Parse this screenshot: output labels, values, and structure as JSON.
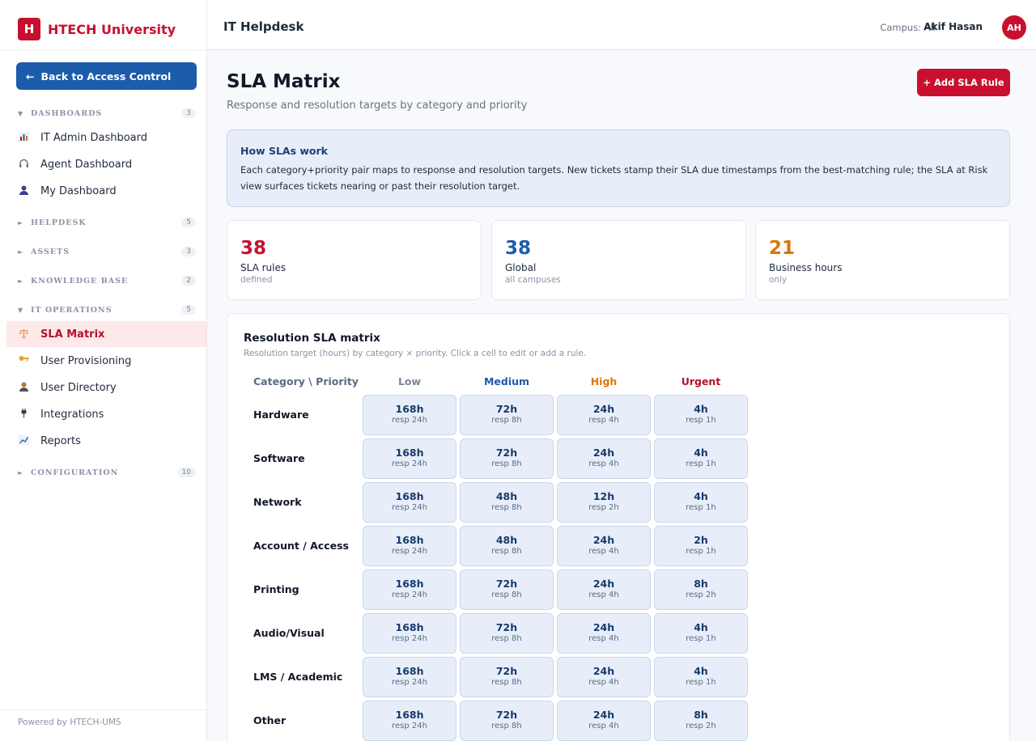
{
  "brand": {
    "logo_letter": "H",
    "name": "HTECH University",
    "accent": "#c8102e"
  },
  "sidebar": {
    "back_label": "Back to Access Control",
    "back_arrow": "←",
    "sections": [
      {
        "label": "DASHBOARDS",
        "count": "3",
        "caret": "▼"
      },
      {
        "label": "HELPDESK",
        "count": "5",
        "caret": "►"
      },
      {
        "label": "ASSETS",
        "count": "3",
        "caret": "►"
      },
      {
        "label": "KNOWLEDGE BASE",
        "count": "2",
        "caret": "►"
      },
      {
        "label": "IT OPERATIONS",
        "count": "5",
        "caret": "▼"
      },
      {
        "label": "CONFIGURATION",
        "count": "10",
        "caret": "►"
      }
    ],
    "items": [
      {
        "label": "IT Admin Dashboard",
        "icon": "bar-chart-icon"
      },
      {
        "label": "Agent Dashboard",
        "icon": "headset-icon"
      },
      {
        "label": "My Dashboard",
        "icon": "person-icon"
      },
      {
        "label": "SLA Matrix",
        "icon": "scales-icon"
      },
      {
        "label": "User Provisioning",
        "icon": "key-icon"
      },
      {
        "label": "User Directory",
        "icon": "person-icon"
      },
      {
        "label": "Integrations",
        "icon": "plug-icon"
      },
      {
        "label": "Reports",
        "icon": "line-chart-icon"
      }
    ],
    "footer": "Powered by HTECH-UMS"
  },
  "topbar": {
    "title": "IT Helpdesk",
    "campus": "Campus: All",
    "user_name": "Akif Hasan",
    "user_initials": "AH"
  },
  "page": {
    "title": "SLA Matrix",
    "subtitle": "Response and resolution targets by category and priority",
    "add_button": "+ Add SLA Rule"
  },
  "info": {
    "title": "How SLAs work",
    "body": "Each category+priority pair maps to response and resolution targets. New tickets stamp their SLA due timestamps from the best-matching rule; the SLA at Risk view surfaces tickets nearing or past their resolution target."
  },
  "stats": [
    {
      "value": "38",
      "label": "SLA rules",
      "sub": "defined",
      "color": "#c8102e"
    },
    {
      "value": "38",
      "label": "Global",
      "sub": "all campuses",
      "color": "#1d5bab"
    },
    {
      "value": "21",
      "label": "Business hours",
      "sub": "only",
      "color": "#d97706"
    }
  ],
  "matrix": {
    "title": "Resolution SLA matrix",
    "subtitle": "Resolution target (hours) by category × priority. Click a cell to edit or add a rule.",
    "corner": "Category \\ Priority",
    "priorities": [
      {
        "label": "Low",
        "color": "#7b8597"
      },
      {
        "label": "Medium",
        "color": "#1d5bab"
      },
      {
        "label": "High",
        "color": "#d97706"
      },
      {
        "label": "Urgent",
        "color": "#b3122b"
      }
    ],
    "rows": [
      {
        "category": "Hardware",
        "cells": [
          {
            "res": "168h",
            "resp": "resp 24h"
          },
          {
            "res": "72h",
            "resp": "resp 8h"
          },
          {
            "res": "24h",
            "resp": "resp 4h"
          },
          {
            "res": "4h",
            "resp": "resp 1h"
          }
        ]
      },
      {
        "category": "Software",
        "cells": [
          {
            "res": "168h",
            "resp": "resp 24h"
          },
          {
            "res": "72h",
            "resp": "resp 8h"
          },
          {
            "res": "24h",
            "resp": "resp 4h"
          },
          {
            "res": "4h",
            "resp": "resp 1h"
          }
        ]
      },
      {
        "category": "Network",
        "cells": [
          {
            "res": "168h",
            "resp": "resp 24h"
          },
          {
            "res": "48h",
            "resp": "resp 8h"
          },
          {
            "res": "12h",
            "resp": "resp 2h"
          },
          {
            "res": "4h",
            "resp": "resp 1h"
          }
        ]
      },
      {
        "category": "Account / Access",
        "cells": [
          {
            "res": "168h",
            "resp": "resp 24h"
          },
          {
            "res": "48h",
            "resp": "resp 8h"
          },
          {
            "res": "24h",
            "resp": "resp 4h"
          },
          {
            "res": "2h",
            "resp": "resp 1h"
          }
        ]
      },
      {
        "category": "Printing",
        "cells": [
          {
            "res": "168h",
            "resp": "resp 24h"
          },
          {
            "res": "72h",
            "resp": "resp 8h"
          },
          {
            "res": "24h",
            "resp": "resp 4h"
          },
          {
            "res": "8h",
            "resp": "resp 2h"
          }
        ]
      },
      {
        "category": "Audio/Visual",
        "cells": [
          {
            "res": "168h",
            "resp": "resp 24h"
          },
          {
            "res": "72h",
            "resp": "resp 8h"
          },
          {
            "res": "24h",
            "resp": "resp 4h"
          },
          {
            "res": "4h",
            "resp": "resp 1h"
          }
        ]
      },
      {
        "category": "LMS / Academic",
        "cells": [
          {
            "res": "168h",
            "resp": "resp 24h"
          },
          {
            "res": "72h",
            "resp": "resp 8h"
          },
          {
            "res": "24h",
            "resp": "resp 4h"
          },
          {
            "res": "4h",
            "resp": "resp 1h"
          }
        ]
      },
      {
        "category": "Other",
        "cells": [
          {
            "res": "168h",
            "resp": "resp 24h"
          },
          {
            "res": "72h",
            "resp": "resp 8h"
          },
          {
            "res": "24h",
            "resp": "resp 4h"
          },
          {
            "res": "8h",
            "resp": "resp 2h"
          }
        ]
      }
    ]
  }
}
